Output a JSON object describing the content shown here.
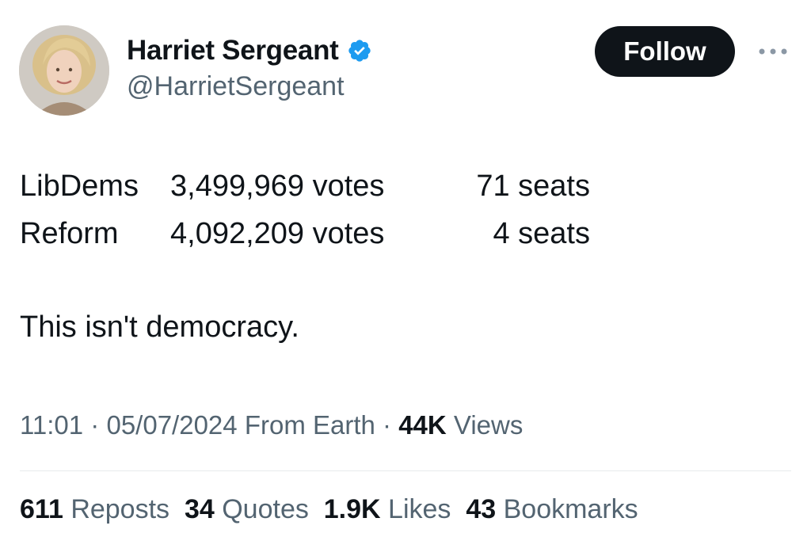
{
  "author": {
    "display_name": "Harriet Sergeant",
    "handle": "@HarrietSergeant",
    "verified": true
  },
  "actions": {
    "follow_label": "Follow",
    "more_icon": "more-horizontal-icon"
  },
  "tweet": {
    "rows": [
      {
        "party": "LibDems",
        "votes": "3,499,969 votes",
        "seats": "71 seats"
      },
      {
        "party": "Reform",
        "votes": "4,092,209 votes",
        "seats": "4 seats"
      }
    ],
    "closing": "This isn't democracy."
  },
  "meta": {
    "time": "11:01",
    "date": "05/07/2024",
    "source": "From Earth",
    "views_count": "44K",
    "views_label": "Views"
  },
  "stats": {
    "reposts_count": "611",
    "reposts_label": "Reposts",
    "quotes_count": "34",
    "quotes_label": "Quotes",
    "likes_count": "1.9K",
    "likes_label": "Likes",
    "bookmarks_count": "43",
    "bookmarks_label": "Bookmarks"
  },
  "colors": {
    "text_primary": "#0f1419",
    "text_secondary": "#536471",
    "verified_blue": "#1d9bf0",
    "follow_bg": "#0f1419"
  }
}
